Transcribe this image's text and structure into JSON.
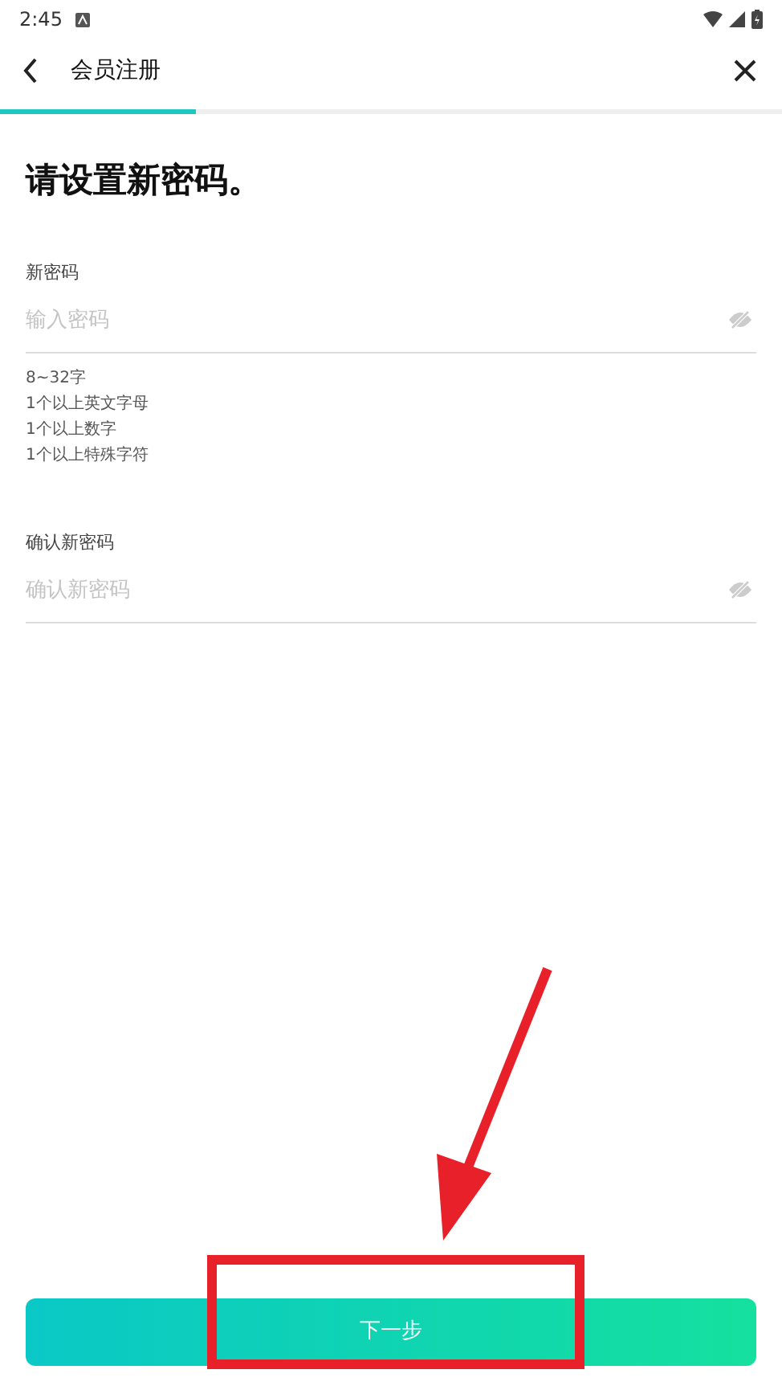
{
  "status_bar": {
    "time": "2:45"
  },
  "app_bar": {
    "title": "会员注册"
  },
  "progress": {
    "level": 0.25
  },
  "heading": "请设置新密码。",
  "fields": [
    {
      "label": "新密码",
      "placeholder": "输入密码",
      "hints": [
        "8~32字",
        "1个以上英文字母",
        "1个以上数字",
        "1个以上特殊字符"
      ]
    },
    {
      "label": "确认新密码",
      "placeholder": "确认新密码"
    }
  ],
  "button": "下一步"
}
